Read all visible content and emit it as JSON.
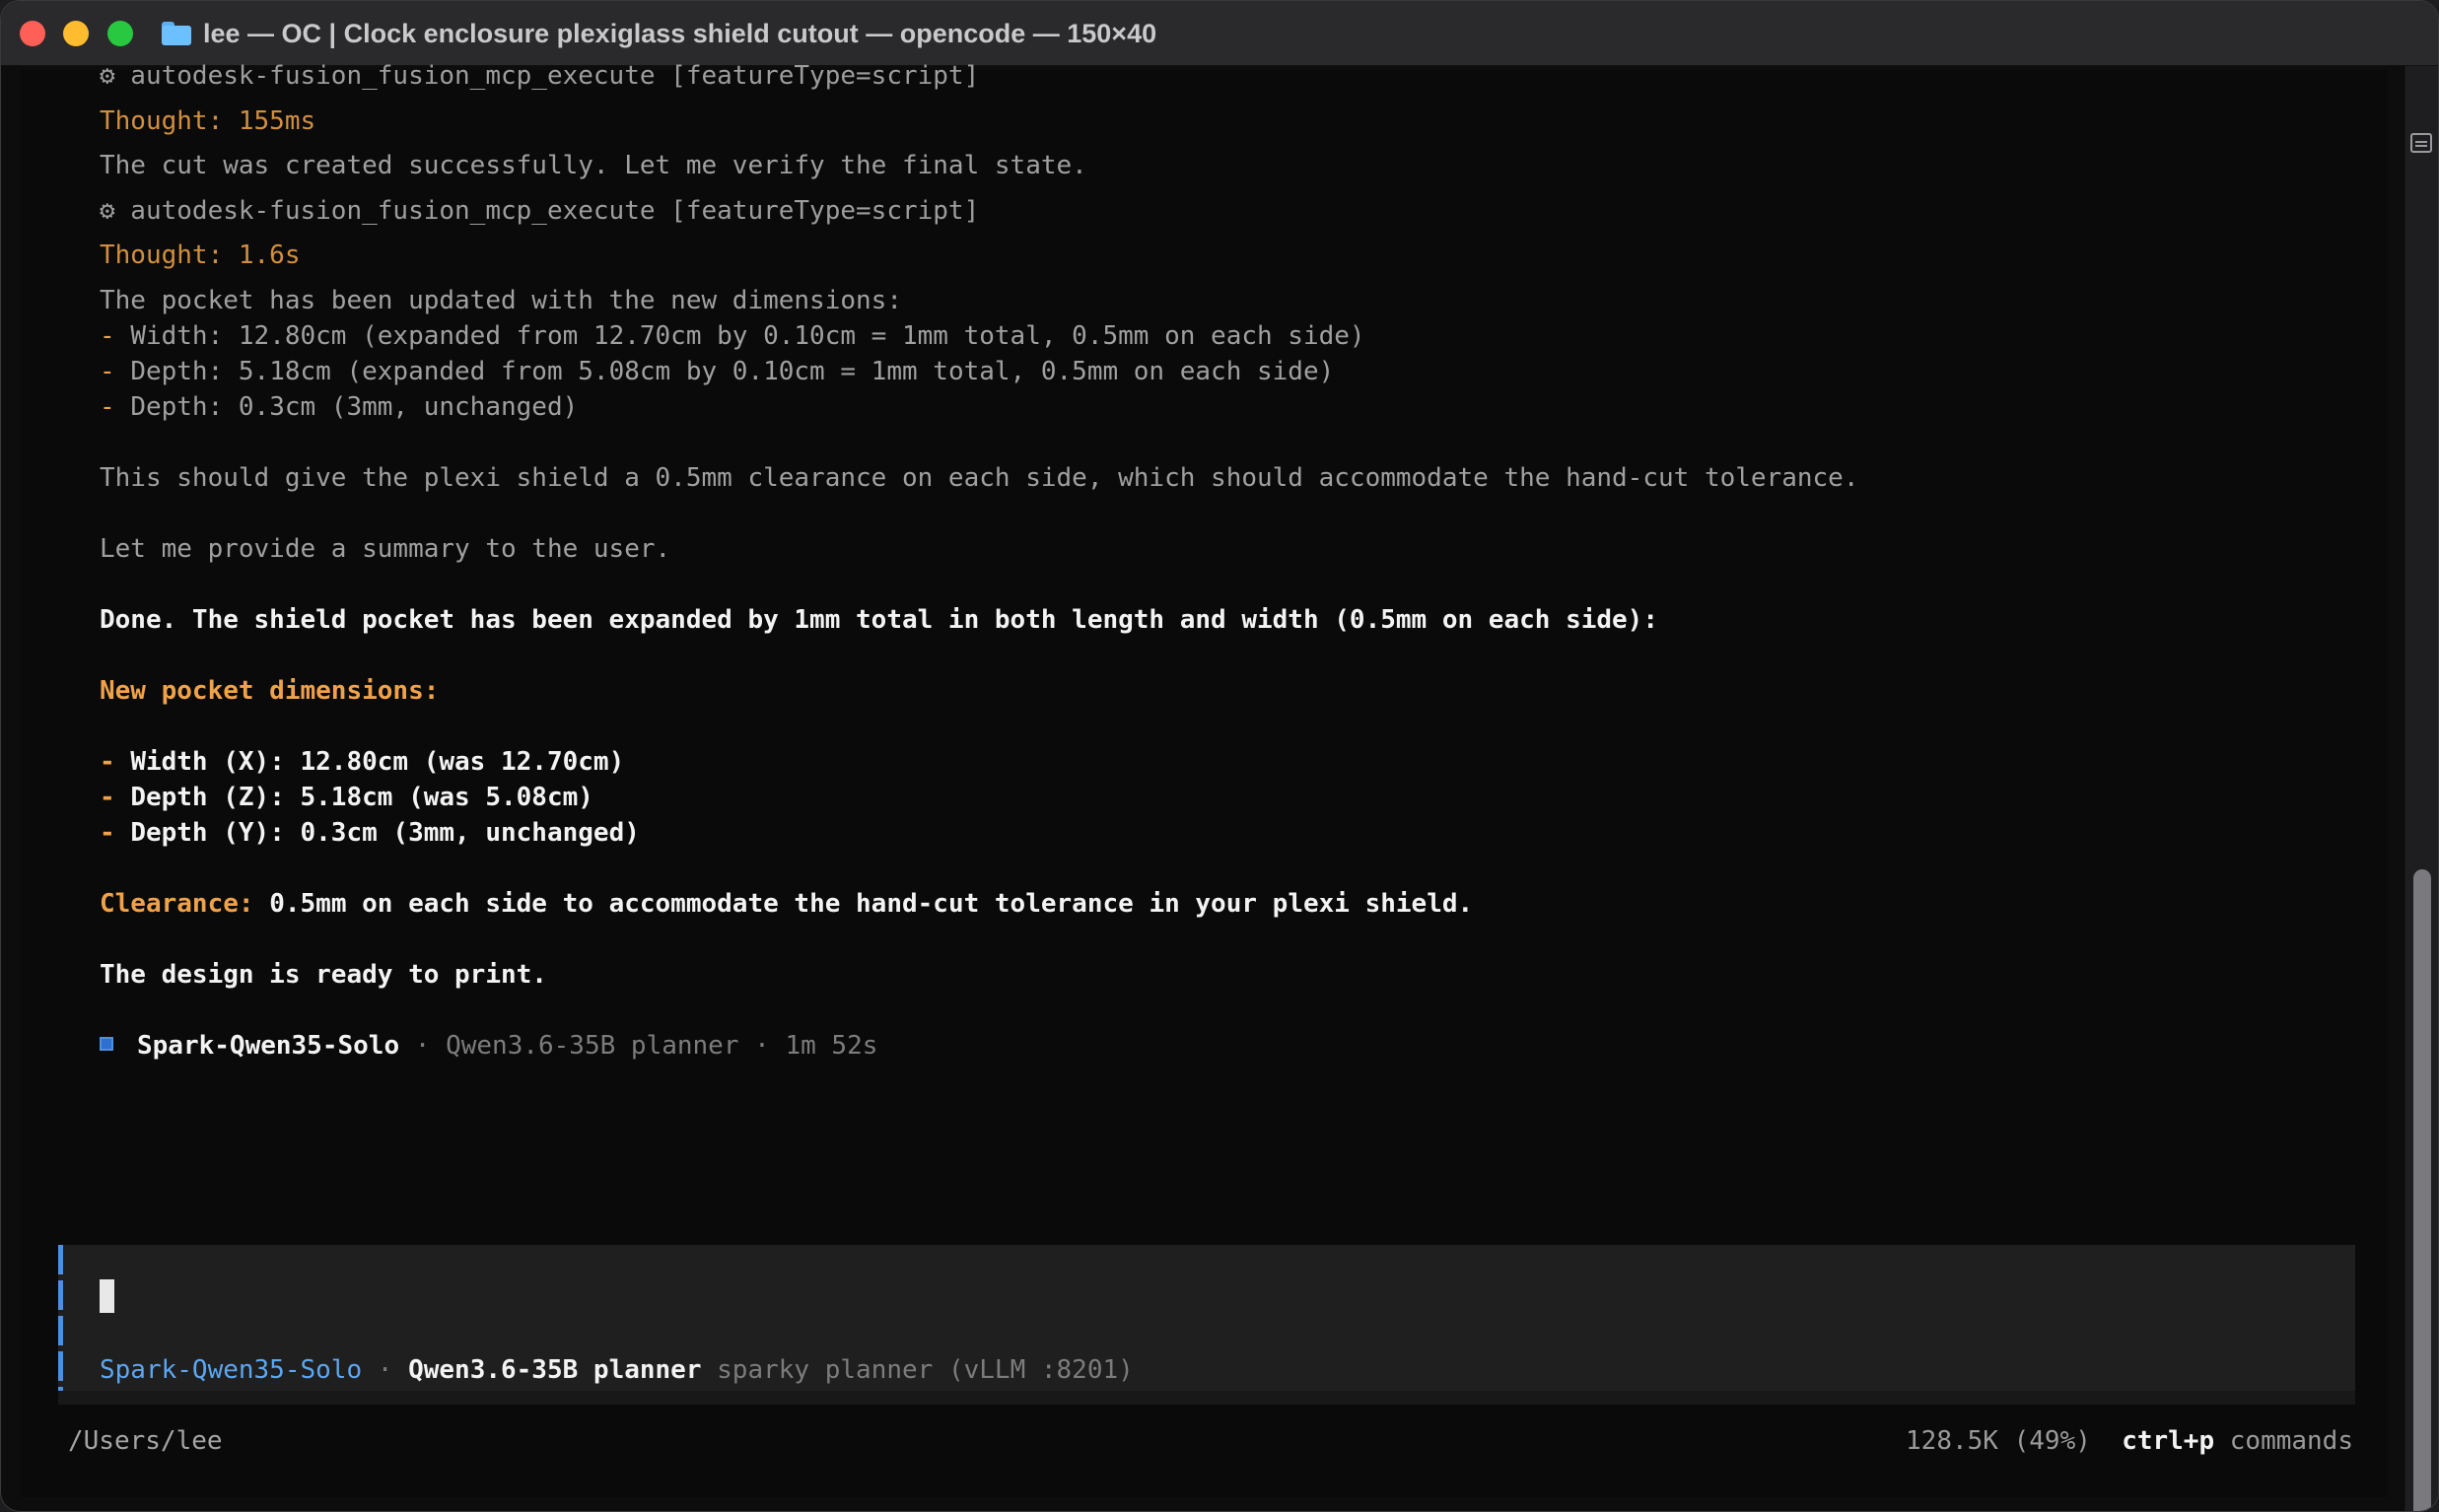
{
  "window": {
    "title": "lee — OC | Clock enclosure plexiglass shield cutout — opencode — 150×40"
  },
  "transcript": {
    "tool_call_1": "⚙ autodesk-fusion_fusion_mcp_execute [featureType=script]",
    "thought_1": "Thought: 155ms",
    "text_1": "The cut was created successfully. Let me verify the final state.",
    "tool_call_2": "⚙ autodesk-fusion_fusion_mcp_execute [featureType=script]",
    "thought_2": "Thought: 1.6s",
    "reasoning_intro": "The pocket has been updated with the new dimensions:",
    "reasoning_bullets": [
      "Width: 12.80cm (expanded from 12.70cm by 0.10cm = 1mm total, 0.5mm on each side)",
      "Depth: 5.18cm (expanded from 5.08cm by 0.10cm = 1mm total, 0.5mm on each side)",
      "Depth: 0.3cm (3mm, unchanged)"
    ],
    "reasoning_2": "This should give the plexi shield a 0.5mm clearance on each side, which should accommodate the hand-cut tolerance.",
    "reasoning_3": "Let me provide a summary to the user.",
    "answer_intro": "Done. The shield pocket has been expanded by 1mm total in both length and width (0.5mm on each side):",
    "answer_heading": "New pocket dimensions:",
    "answer_bullets": [
      "Width (X): 12.80cm (was 12.70cm)",
      "Depth (Z): 5.18cm (was 5.08cm)",
      "Depth (Y): 0.3cm (3mm, unchanged)"
    ],
    "clearance_label": "Clearance:",
    "clearance_text": " 0.5mm on each side to accommodate the hand-cut tolerance in your plexi shield.",
    "closing": "The design is ready to print.",
    "bullet_marker": "-"
  },
  "model_footer": {
    "agent": "Spark-Qwen35-Solo",
    "sep": " · ",
    "model": "Qwen3.6-35B planner",
    "duration": "1m 52s"
  },
  "prompt": {
    "agent": "Spark-Qwen35-Solo",
    "sep": " · ",
    "model": "Qwen3.6-35B planner",
    "provider": "sparky planner (vLLM :8201)"
  },
  "status": {
    "path": "/Users/lee",
    "tokens": "128.5K (49%)",
    "shortcut": "ctrl+p",
    "shortcut_label": "commands"
  },
  "colors": {
    "accent_blue": "#5da6f0",
    "thought_orange": "#d38f3e",
    "heading_orange": "#f0a24a"
  }
}
